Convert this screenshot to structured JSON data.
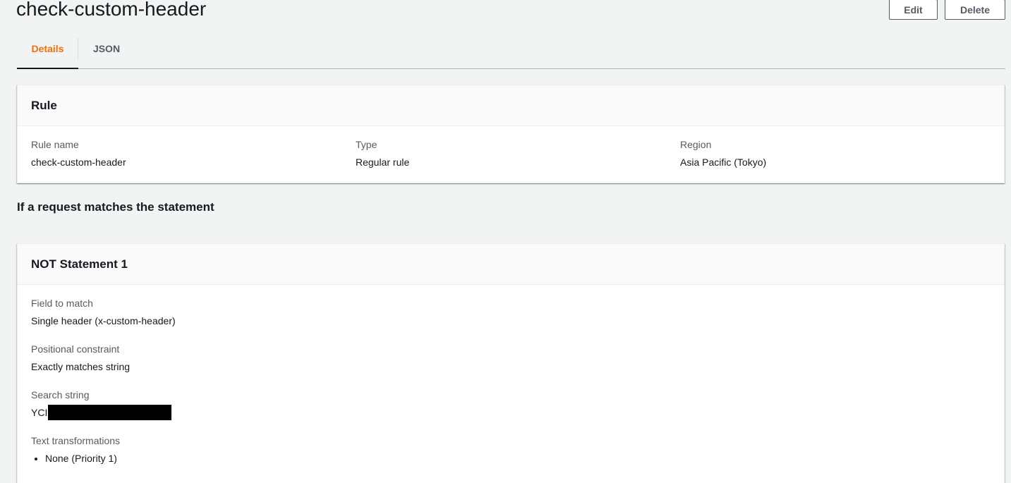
{
  "header": {
    "title": "check-custom-header",
    "edit_label": "Edit",
    "delete_label": "Delete"
  },
  "tabs": [
    {
      "label": "Details",
      "active": true
    },
    {
      "label": "JSON",
      "active": false
    }
  ],
  "rule_panel": {
    "heading": "Rule",
    "fields": [
      {
        "label": "Rule name",
        "value": "check-custom-header"
      },
      {
        "label": "Type",
        "value": "Regular rule"
      },
      {
        "label": "Region",
        "value": "Asia Pacific (Tokyo)"
      }
    ]
  },
  "statement_heading": "If a request matches the statement",
  "statement_panel": {
    "heading": "NOT Statement 1",
    "field_to_match": {
      "label": "Field to match",
      "value": "Single header (x-custom-header)"
    },
    "positional_constraint": {
      "label": "Positional constraint",
      "value": "Exactly matches string"
    },
    "search_string": {
      "label": "Search string",
      "value": "YCI"
    },
    "text_transformations": {
      "label": "Text transformations",
      "items": [
        "None (Priority 1)"
      ]
    }
  },
  "colors": {
    "accent": "#ec7211",
    "background": "#f2f3f3",
    "text": "#16191f",
    "muted": "#545b64"
  }
}
